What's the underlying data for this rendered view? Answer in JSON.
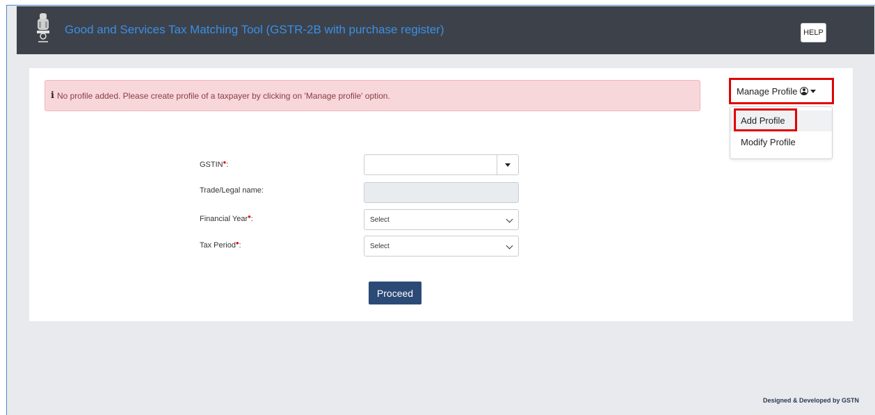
{
  "header": {
    "title": "Good and Services Tax Matching Tool (GSTR-2B with purchase register)",
    "help_label": "HELP",
    "emblem_icon": "national-emblem-icon",
    "title_color": "#3a8fe6",
    "bar_color": "#3d424a"
  },
  "alert": {
    "icon": "info-icon",
    "icon_glyph": "i",
    "message": "No profile added. Please create profile of a taxpayer by clicking on 'Manage profile' option."
  },
  "manage_profile": {
    "label": "Manage Profile",
    "icon": "user-circle-icon",
    "menu": {
      "add": "Add Profile",
      "modify": "Modify Profile"
    }
  },
  "form": {
    "gstin_label": "GSTIN",
    "trade_label": "Trade/Legal name:",
    "fy_label": "Financial Year",
    "tax_label": "Tax Period",
    "required_mark": "•",
    "colon": ":",
    "gstin_value": "",
    "trade_value": "",
    "fy_selected": "Select",
    "tax_selected": "Select"
  },
  "proceed_label": "Proceed",
  "footer": "Designed & Developed by GSTN",
  "colors": {
    "highlight_red": "#e00000",
    "proceed_bg": "#2c4a76",
    "alert_bg": "#f8d7da"
  }
}
